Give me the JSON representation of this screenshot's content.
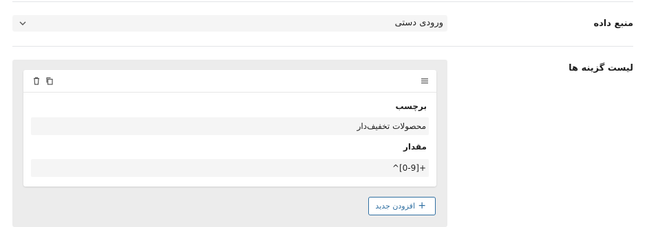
{
  "data_source": {
    "label": "منبع داده",
    "selected": "ورودی دستی",
    "icons": {
      "dropdown": "chevron-down-icon"
    }
  },
  "options_list": {
    "label": "لیست گزینه ها",
    "items": [
      {
        "label_title": "برچسب",
        "label_value": "محصولات تخفیف‌دار",
        "value_title": "مقدار",
        "value_value": "^[0-9]+",
        "icons": {
          "drag": "drag-handle-icon",
          "duplicate": "copy-icon",
          "delete": "trash-icon"
        }
      }
    ],
    "add_button": "افزودن جدید"
  },
  "colors": {
    "accent": "#2f6fa1",
    "panel_bg": "#ececec",
    "field_bg": "#f5f5f5",
    "divider": "#e2e4e7"
  }
}
